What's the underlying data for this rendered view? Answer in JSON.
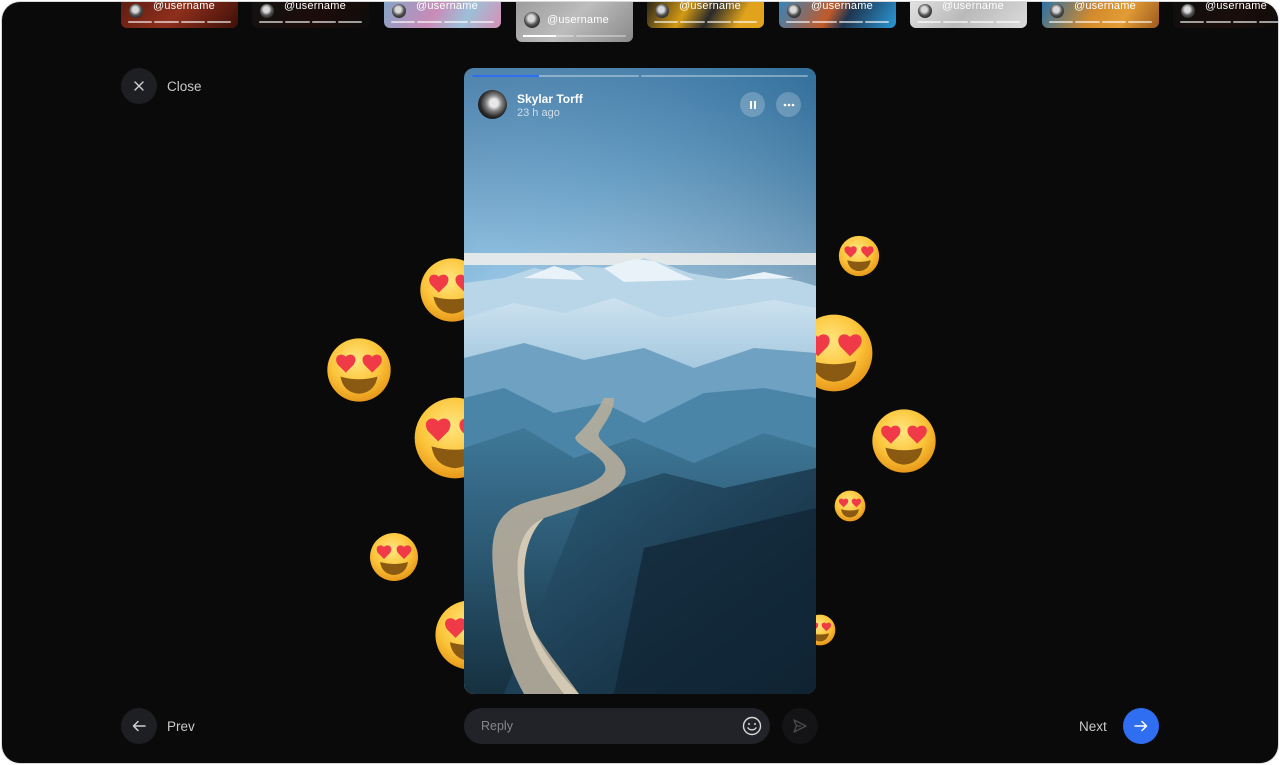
{
  "stories_strip": [
    {
      "username": "@username",
      "theme": "red",
      "active": false,
      "segments": 4
    },
    {
      "username": "@username",
      "theme": "black",
      "active": false,
      "segments": 4
    },
    {
      "username": "@username",
      "theme": "pink-blue",
      "active": false,
      "segments": 4
    },
    {
      "username": "@username",
      "theme": "silver",
      "active": true,
      "segments": 2
    },
    {
      "username": "@username",
      "theme": "yellow-black",
      "active": false,
      "segments": 4
    },
    {
      "username": "@username",
      "theme": "blue-orange",
      "active": false,
      "segments": 4
    },
    {
      "username": "@username",
      "theme": "white",
      "active": false,
      "segments": 4
    },
    {
      "username": "@username",
      "theme": "orange-blue",
      "active": false,
      "segments": 4
    },
    {
      "username": "@username",
      "theme": "dark",
      "active": false,
      "segments": 4
    }
  ],
  "close": {
    "label": "Close",
    "icon": "close-icon"
  },
  "prev": {
    "label": "Prev",
    "icon": "arrow-left-icon"
  },
  "next": {
    "label": "Next",
    "icon": "arrow-right-icon"
  },
  "story": {
    "author": "Skylar Torff",
    "time": "23 h ago",
    "progress": [
      0.4,
      0
    ],
    "pause_icon": "pause-icon",
    "more_icon": "more-icon",
    "image_subject": "aerial view of mountains with winding river",
    "accent_color": "#2f6ef0"
  },
  "reply": {
    "placeholder": "Reply",
    "value": "",
    "emoji_icon": "emoji-icon",
    "send_icon": "send-icon"
  },
  "reactions": {
    "emoji": "heart-eyes-emoji",
    "count": 10
  },
  "colors": {
    "background": "#0a0a0a",
    "accent": "#2f6ef0",
    "control_bg": "#1e1f22"
  }
}
